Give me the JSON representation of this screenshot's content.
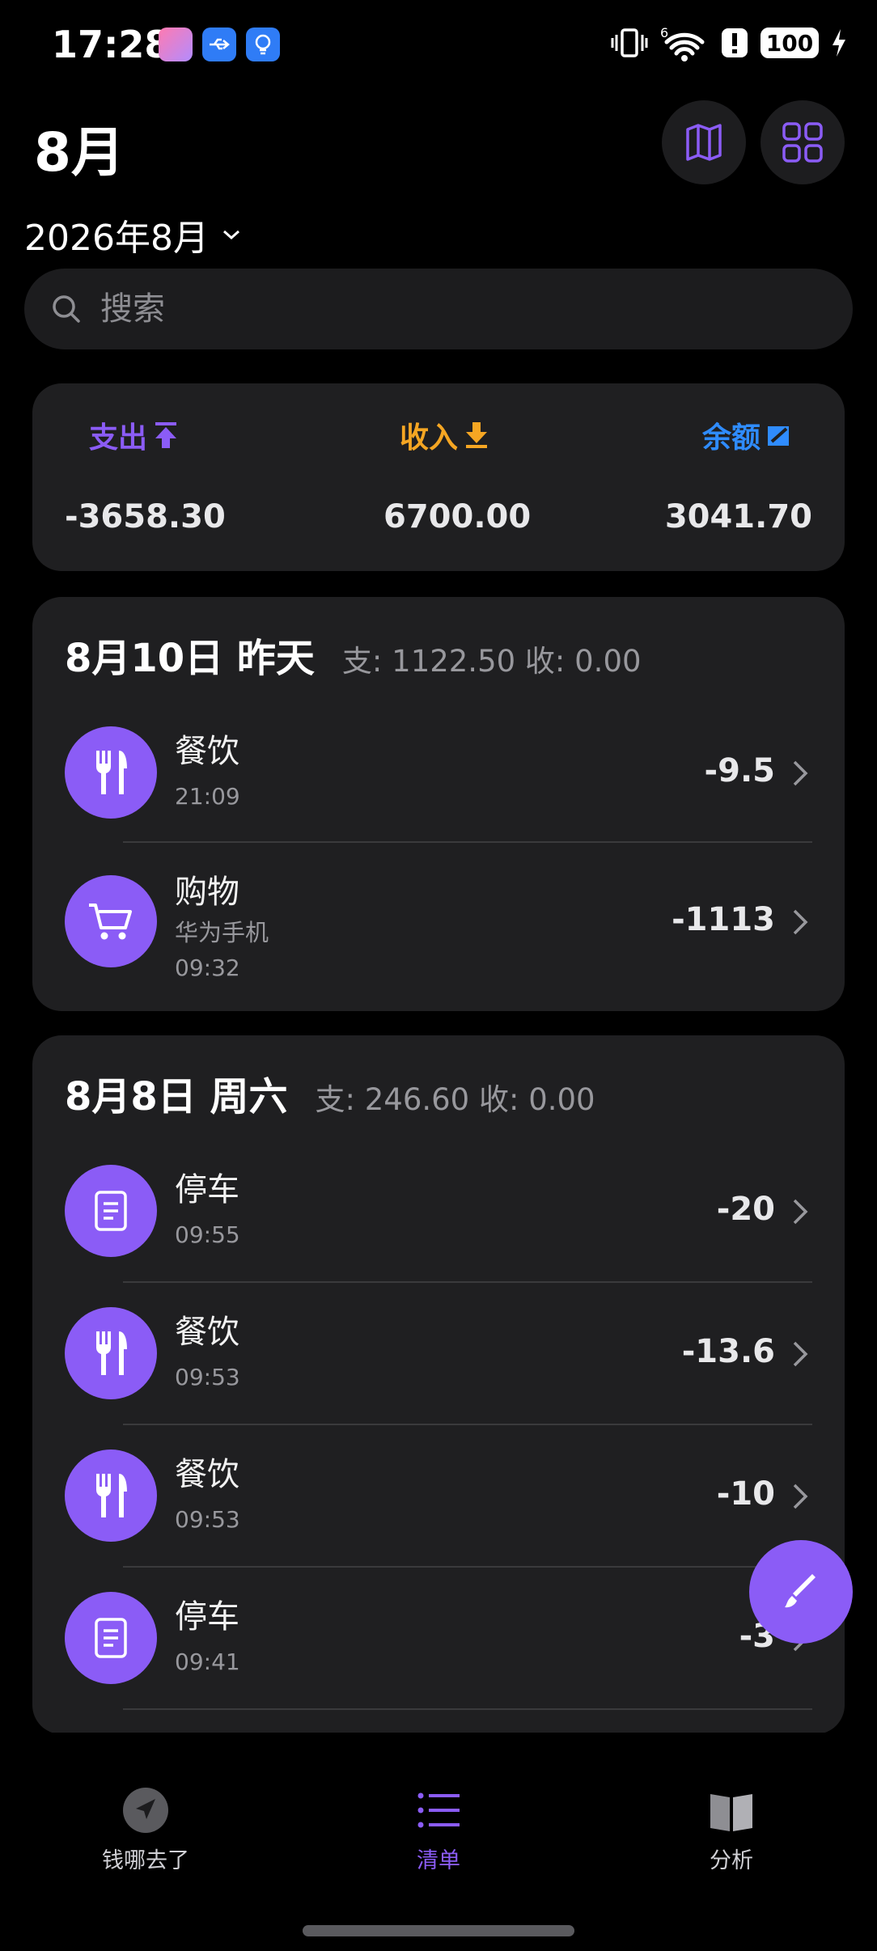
{
  "status_bar": {
    "time": "17:28",
    "battery": "100"
  },
  "header": {
    "title": "8月",
    "date_selector": "2026年8月"
  },
  "search": {
    "placeholder": "搜索"
  },
  "summary": {
    "expense_label": "支出",
    "income_label": "收入",
    "balance_label": "余额",
    "expense_value": "-3658.30",
    "income_value": "6700.00",
    "balance_value": "3041.70",
    "colors": {
      "expense": "#8b5cf6",
      "income": "#f5a623",
      "balance": "#2f8cff"
    }
  },
  "days": [
    {
      "title": "8月10日 昨天",
      "stats": "支: 1122.50  收: 0.00",
      "items": [
        {
          "icon": "fork-knife-icon",
          "category": "餐饮",
          "note": "",
          "time": "21:09",
          "amount": "-9.5"
        },
        {
          "icon": "cart-icon",
          "category": "购物",
          "note": "华为手机",
          "time": "09:32",
          "amount": "-1113"
        }
      ]
    },
    {
      "title": "8月8日 周六",
      "stats": "支: 246.60  收: 0.00",
      "items": [
        {
          "icon": "receipt-icon",
          "category": "停车",
          "note": "",
          "time": "09:55",
          "amount": "-20"
        },
        {
          "icon": "fork-knife-icon",
          "category": "餐饮",
          "note": "",
          "time": "09:53",
          "amount": "-13.6"
        },
        {
          "icon": "fork-knife-icon",
          "category": "餐饮",
          "note": "",
          "time": "09:53",
          "amount": "-10"
        },
        {
          "icon": "receipt-icon",
          "category": "停车",
          "note": "",
          "time": "09:41",
          "amount": "-3"
        }
      ]
    }
  ],
  "nav": {
    "items": [
      {
        "label": "钱哪去了",
        "icon": "navigation-arrow-icon"
      },
      {
        "label": "清单",
        "icon": "list-icon"
      },
      {
        "label": "分析",
        "icon": "book-icon"
      }
    ],
    "active_color": "#8b5cf6",
    "inactive_color": "#d1d1d6"
  },
  "accent_color": "#8b5cf6"
}
